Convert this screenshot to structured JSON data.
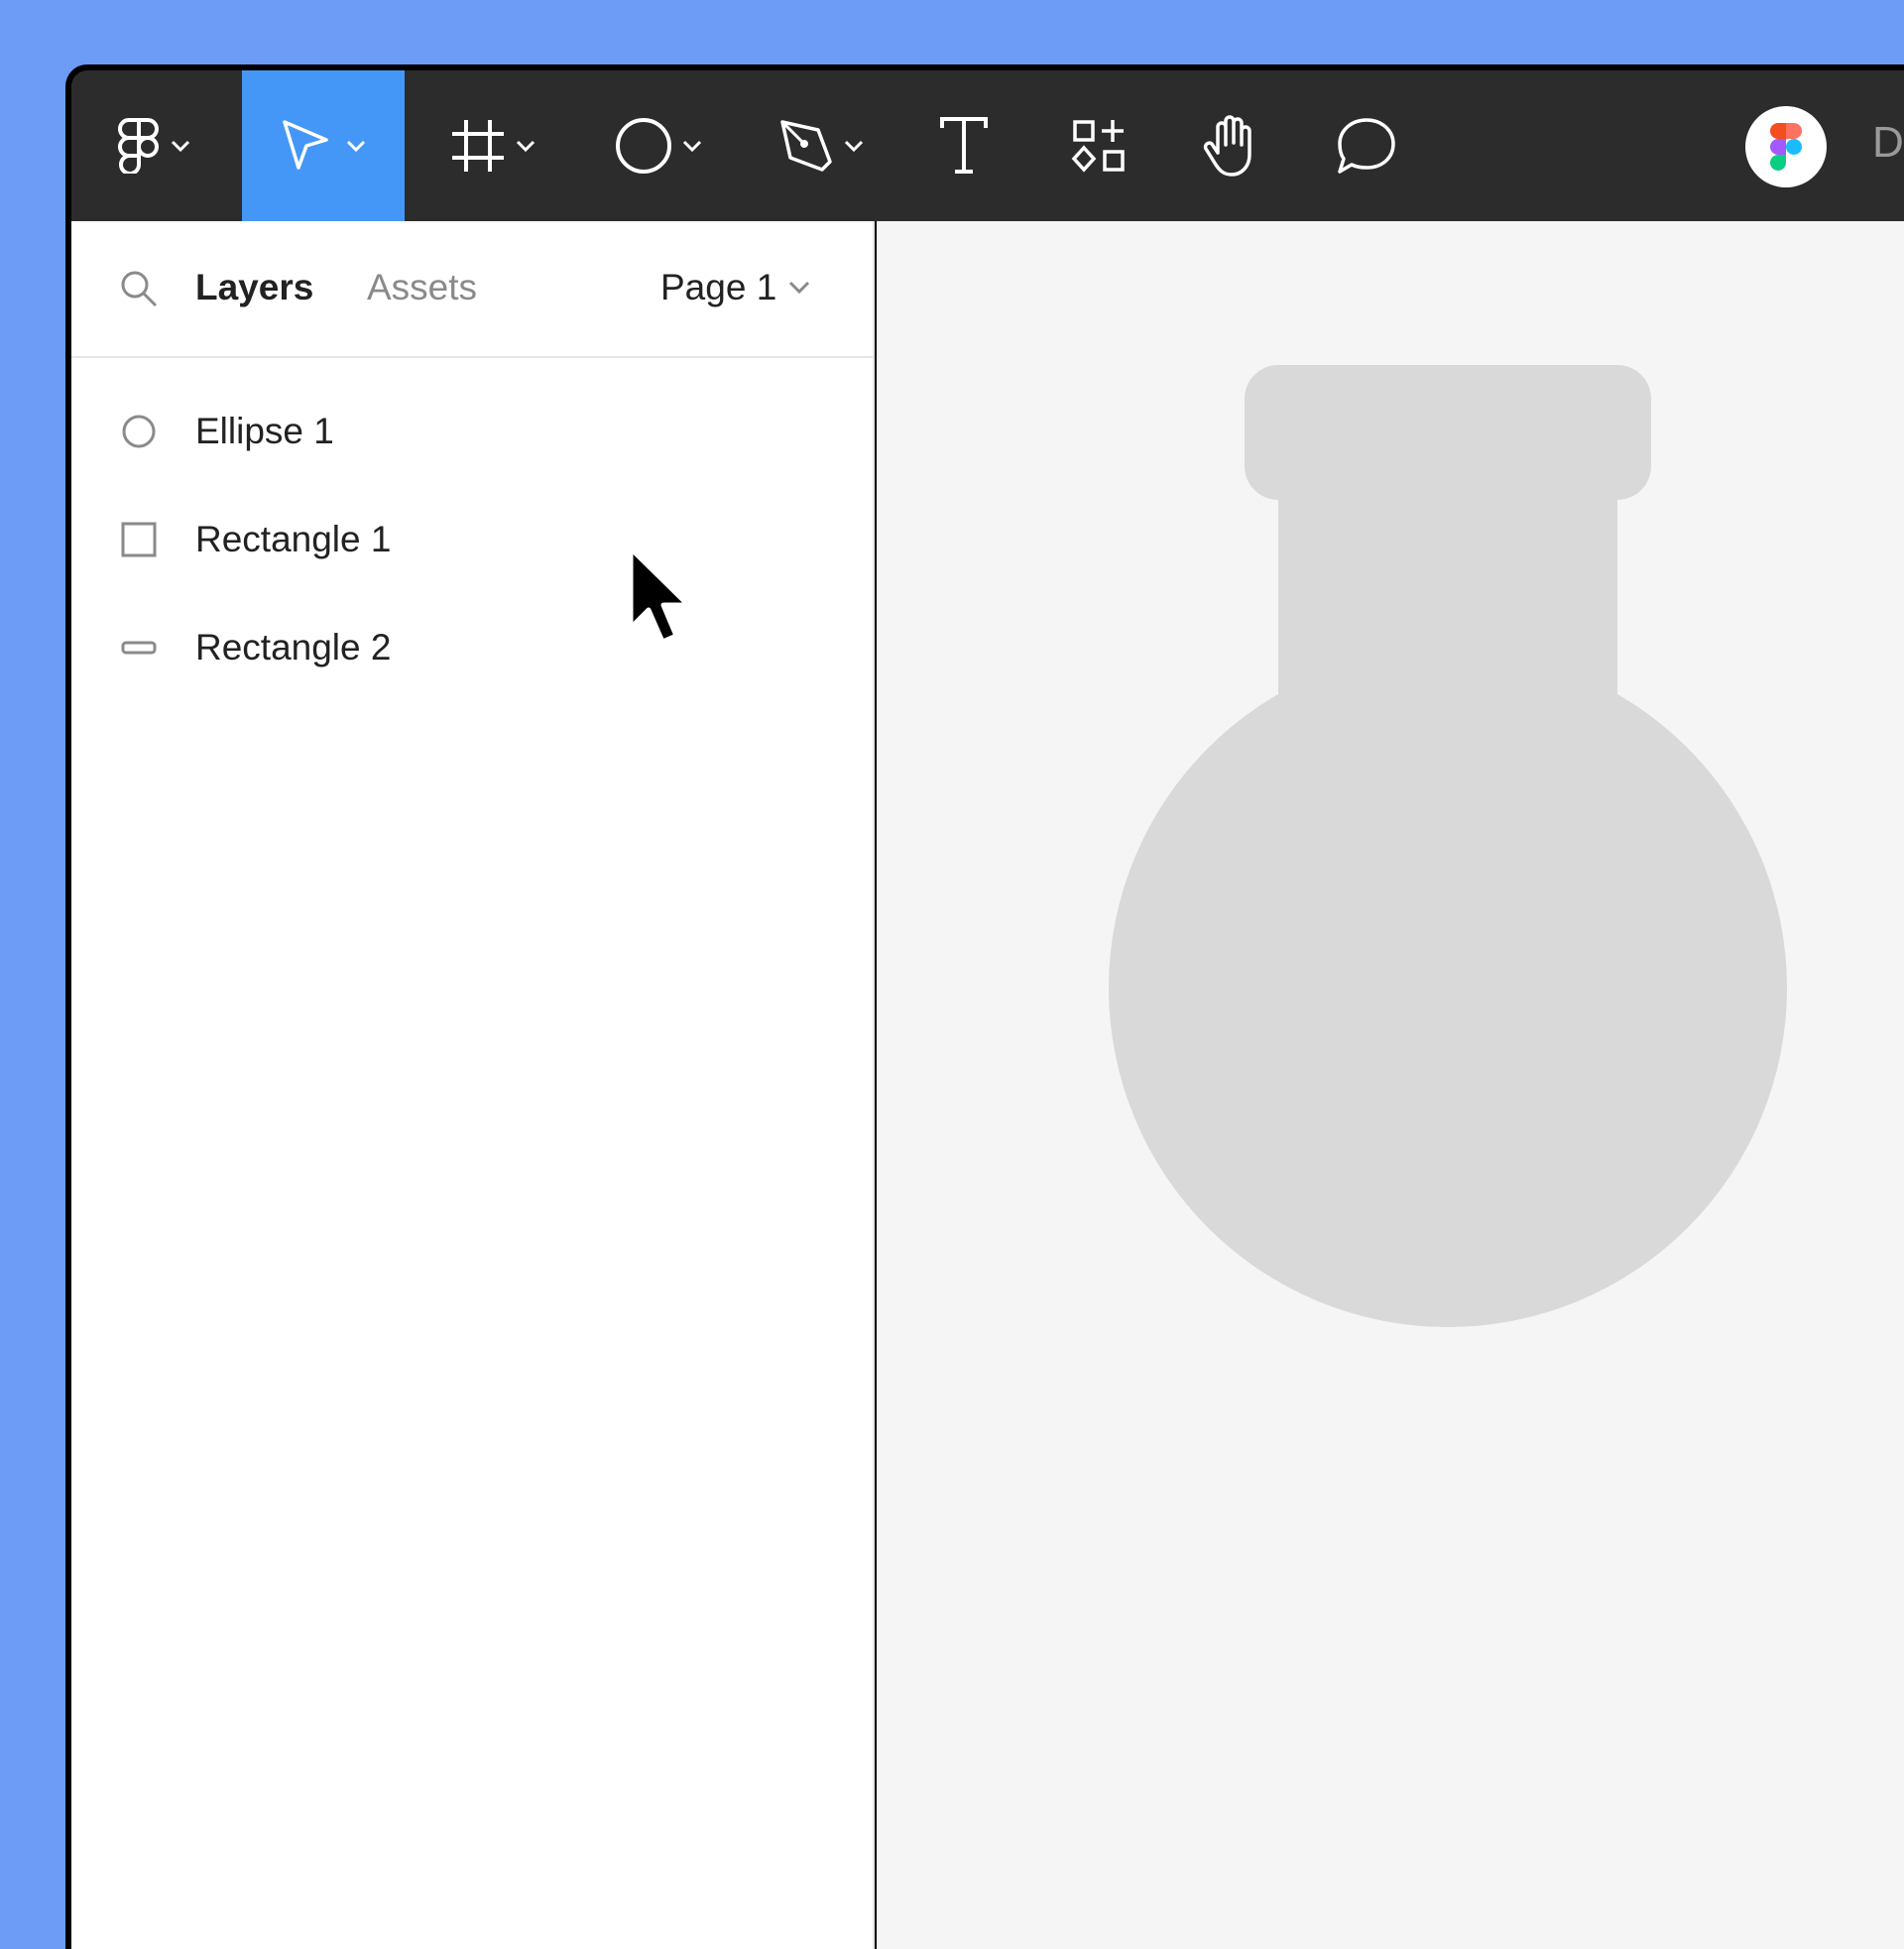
{
  "toolbar": {
    "tools": [
      {
        "name": "main-menu",
        "icon": "figma-logo-icon",
        "has_caret": true
      },
      {
        "name": "move-tool",
        "icon": "pointer-icon",
        "has_caret": true,
        "active": true
      },
      {
        "name": "frame-tool",
        "icon": "frame-icon",
        "has_caret": true
      },
      {
        "name": "shape-tool",
        "icon": "ellipse-icon",
        "has_caret": true
      },
      {
        "name": "pen-tool",
        "icon": "pen-icon",
        "has_caret": true
      },
      {
        "name": "text-tool",
        "icon": "text-icon",
        "has_caret": false
      },
      {
        "name": "resources-tool",
        "icon": "resources-icon",
        "has_caret": false
      },
      {
        "name": "hand-tool",
        "icon": "hand-icon",
        "has_caret": false
      },
      {
        "name": "comment-tool",
        "icon": "comment-icon",
        "has_caret": false
      }
    ],
    "title_partial": "D",
    "active_color": "#4597f7",
    "background_color": "#2c2c2c"
  },
  "sidebar": {
    "tabs": [
      {
        "label": "Layers",
        "active": true
      },
      {
        "label": "Assets",
        "active": false
      }
    ],
    "page_selector": "Page 1",
    "layers": [
      {
        "label": "Ellipse 1",
        "icon": "ellipse-layer-icon"
      },
      {
        "label": "Rectangle 1",
        "icon": "rectangle-layer-icon"
      },
      {
        "label": "Rectangle 2",
        "icon": "thin-rectangle-layer-icon"
      }
    ]
  },
  "canvas": {
    "background_color": "#f5f5f5",
    "shape_color": "#d9d9d9"
  },
  "page_background": "#6c9cf6"
}
